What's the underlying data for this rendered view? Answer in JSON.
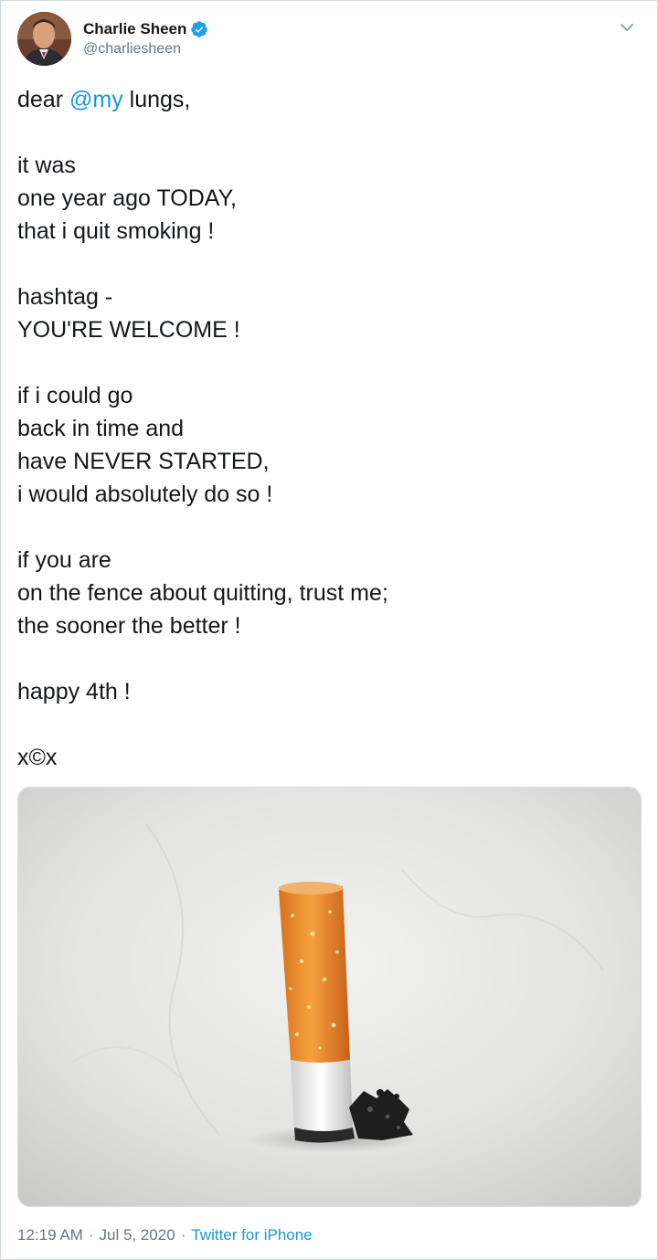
{
  "author": {
    "display_name": "Charlie Sheen",
    "handle": "@charliesheen",
    "verified": true,
    "verified_icon": "verified-badge-icon",
    "avatar_icon": "profile-photo"
  },
  "tweet": {
    "lines": [
      {
        "before": "dear ",
        "mention": "@my",
        "after": " lungs,"
      },
      {
        "text": ""
      },
      {
        "text": "it was"
      },
      {
        "text": "one year ago TODAY,"
      },
      {
        "text": "that i quit smoking !"
      },
      {
        "text": ""
      },
      {
        "text": "hashtag -"
      },
      {
        "text": "YOU'RE WELCOME !"
      },
      {
        "text": ""
      },
      {
        "text": "if i could go"
      },
      {
        "text": "back in time and"
      },
      {
        "text": "have NEVER STARTED,"
      },
      {
        "text": "i would absolutely do so !"
      },
      {
        "text": ""
      },
      {
        "text": "if you are"
      },
      {
        "text": "on the fence about quitting, trust me;"
      },
      {
        "text": "the sooner the better !"
      },
      {
        "text": ""
      },
      {
        "text": "happy 4th !"
      },
      {
        "text": ""
      },
      {
        "text": "x©x"
      }
    ],
    "media_icon": "cigarette-butt-photo"
  },
  "meta": {
    "time": "12:19 AM",
    "separator": "·",
    "date": "Jul 5, 2020",
    "source": "Twitter for iPhone"
  },
  "colors": {
    "link": "#1b95e0",
    "text": "#14171a",
    "muted": "#657786",
    "border": "#cfd9de"
  },
  "icons": {
    "caret": "chevron-down-icon"
  }
}
